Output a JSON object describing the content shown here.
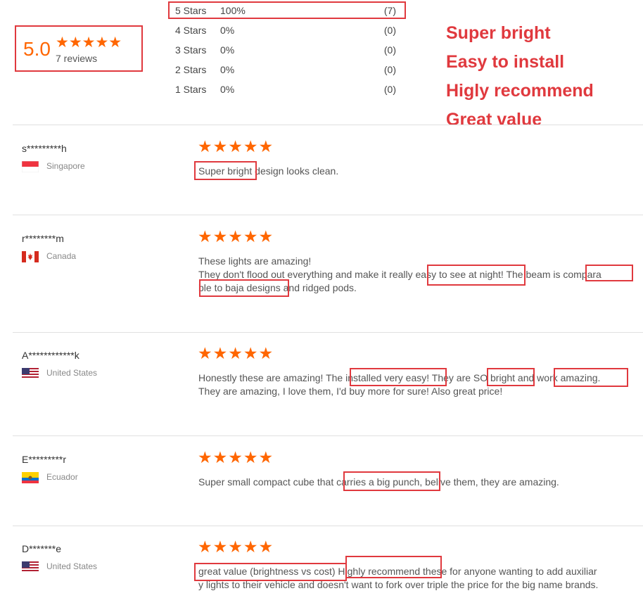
{
  "summary": {
    "score": "5.0",
    "stars": "★★★★★",
    "reviews_label": "7 reviews",
    "rows": [
      {
        "label": "5 Stars",
        "percent": "100%",
        "count": "(7)"
      },
      {
        "label": "4 Stars",
        "percent": "0%",
        "count": "(0)"
      },
      {
        "label": "3 Stars",
        "percent": "0%",
        "count": "(0)"
      },
      {
        "label": "2 Stars",
        "percent": "0%",
        "count": "(0)"
      },
      {
        "label": "1 Stars",
        "percent": "0%",
        "count": "(0)"
      }
    ]
  },
  "highlights": [
    "Super bright",
    "Easy to install",
    "Higly recommend",
    "Great value"
  ],
  "reviews": [
    {
      "user": "s*********h",
      "country": "Singapore",
      "stars": "★★★★★",
      "lines": [
        "Super bright design looks clean."
      ]
    },
    {
      "user": "r********m",
      "country": "Canada",
      "stars": "★★★★★",
      "lines": [
        "These lights are amazing!",
        "They don't flood out everything and make it really easy to see at night! The beam is compara",
        "ble to baja designs and ridged pods."
      ]
    },
    {
      "user": "A************k",
      "country": "United States",
      "stars": "★★★★★",
      "lines": [
        "Honestly these are amazing! The installed very easy! They are SO bright and work amazing.",
        "They are amazing, I love them, I'd buy more for sure! Also great price!"
      ]
    },
    {
      "user": "E*********r",
      "country": "Ecuador",
      "stars": "★★★★★",
      "lines": [
        "Super small compact cube that carries a big punch, belive them, they are amazing."
      ]
    },
    {
      "user": "D*******e",
      "country": "United States",
      "stars": "★★★★★",
      "lines": [
        "great value (brightness vs cost) Highly recommend these for anyone wanting to add auxiliar",
        "y lights to their vehicle and doesn't want to fork over triple the price for the big name brands."
      ]
    }
  ],
  "colors": {
    "accent": "#ff6600",
    "annotation": "#e0393e"
  }
}
